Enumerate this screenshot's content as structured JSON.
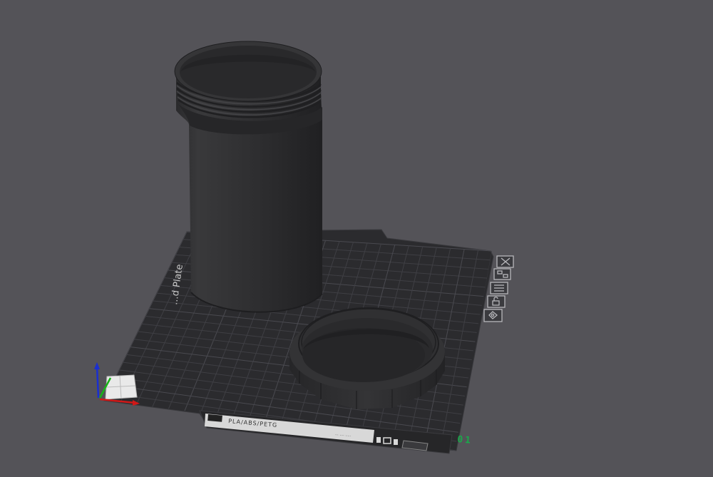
{
  "scene": {
    "background_color": "#545358",
    "bed_color": "#2b2b2e",
    "bed_grid_color": "#3d3d42",
    "model_color": "#2d2d2f",
    "plate_number_color": "#1aa84a"
  },
  "bed": {
    "side_label": "...d Plate",
    "filament_label": "PLA/ABS/PETG",
    "small_label": "... .... .....",
    "plate_number": "01"
  },
  "plate_toolbar": {
    "buttons": [
      {
        "name": "delete-plate",
        "icon": "close-icon"
      },
      {
        "name": "arrange-plate",
        "icon": "arrange-icon"
      },
      {
        "name": "plate-settings",
        "icon": "layers-icon"
      },
      {
        "name": "lock-plate",
        "icon": "lock-icon"
      },
      {
        "name": "auto-orient",
        "icon": "orient-icon"
      }
    ]
  },
  "objects": [
    {
      "name": "jar-body",
      "kind": "threaded cylinder"
    },
    {
      "name": "jar-lid",
      "kind": "threaded cap"
    }
  ],
  "axes": {
    "x_color": "#d01818",
    "y_color": "#17b417",
    "z_color": "#1a2fd0"
  }
}
